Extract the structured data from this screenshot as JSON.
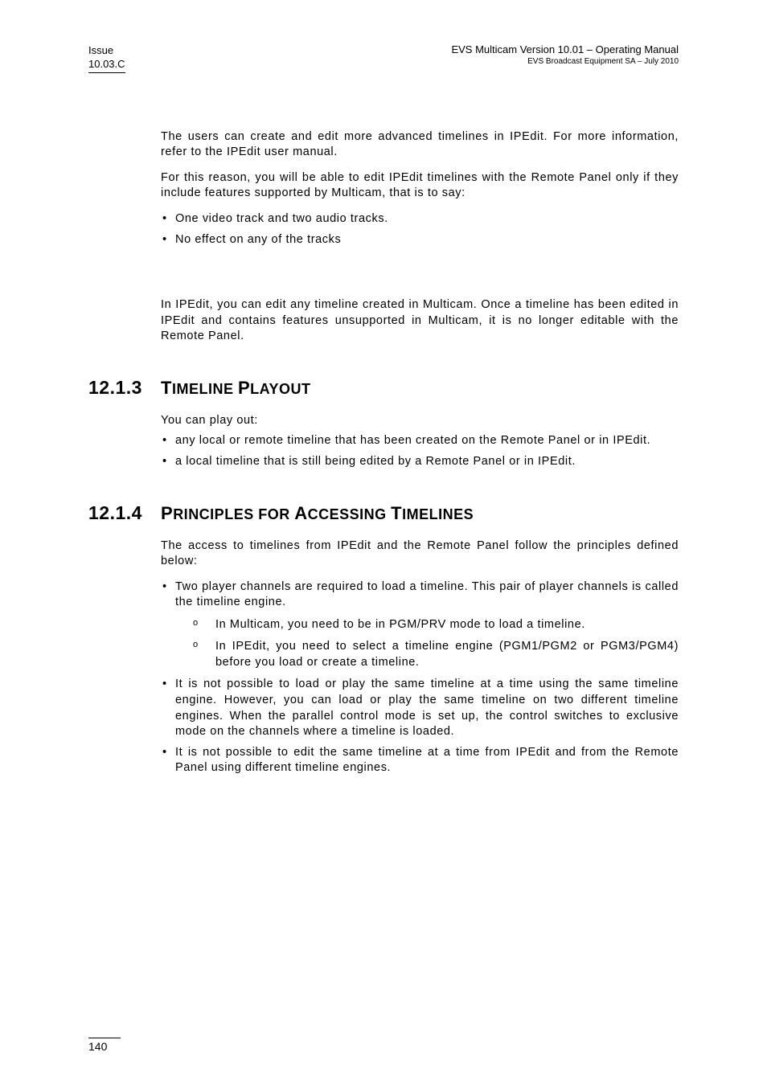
{
  "header": {
    "issue_label": "Issue",
    "issue_value": "10.03.C",
    "right_line1": "EVS Multicam Version 10.01 – Operating Manual",
    "right_line2": "EVS Broadcast Equipment SA – July 2010"
  },
  "body": {
    "p1": "The users can create and edit more advanced timelines in IPEdit. For more information, refer to the IPEdit user manual.",
    "p2": "For this reason, you will be able to edit IPEdit timelines with the Remote Panel only if they include features supported by Multicam, that is to say:",
    "list1": [
      "One video track and two audio tracks.",
      "No effect on any of the tracks"
    ],
    "p3": "In IPEdit, you can edit any timeline created in Multicam. Once a timeline has been edited in IPEdit and contains features unsupported in Multicam, it is no longer editable with the Remote Panel."
  },
  "section_1213": {
    "num": "12.1.3",
    "title_parts": [
      "T",
      "IMELINE ",
      "P",
      "LAYOUT"
    ],
    "p1": "You can play out:",
    "list": [
      "any local or remote timeline that has been created on the Remote Panel or in IPEdit.",
      "a local timeline that is still being edited by a Remote Panel or in IPEdit."
    ]
  },
  "section_1214": {
    "num": "12.1.4",
    "title_parts": [
      "P",
      "RINCIPLES FOR ",
      "A",
      "CCESSING ",
      "T",
      "IMELINES"
    ],
    "p1": "The access to timelines from IPEdit and the Remote Panel follow the principles defined below:",
    "list": [
      {
        "text": "Two player channels are required to load a timeline. This pair of player channels is called the timeline engine.",
        "sub": [
          "In Multicam, you need to be in PGM/PRV mode to load a timeline.",
          "In IPEdit, you need to select a timeline engine (PGM1/PGM2 or PGM3/PGM4) before you load or create a timeline."
        ]
      },
      {
        "text": "It is not possible to load or play the same timeline at a time using the same timeline engine. However, you can load or play the same timeline on two different timeline engines. When the parallel control mode is set up, the control switches to exclusive mode on the channels where a timeline is loaded.",
        "sub": []
      },
      {
        "text": "It is not possible to edit the same timeline at a time from IPEdit and from the Remote Panel using different timeline engines.",
        "sub": []
      }
    ]
  },
  "footer": {
    "page_number": "140"
  }
}
